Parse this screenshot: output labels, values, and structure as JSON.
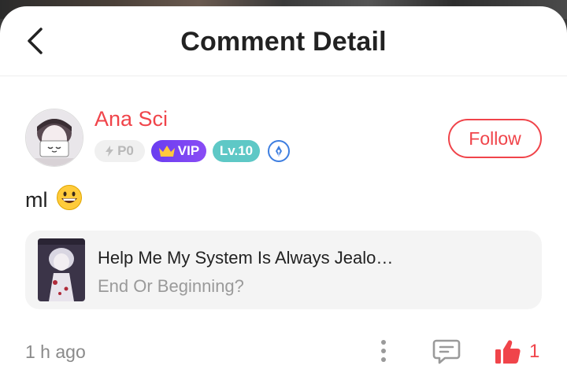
{
  "header": {
    "title": "Comment Detail"
  },
  "comment": {
    "username": "Ana Sci",
    "badges": {
      "power": "P0",
      "vip": "VIP",
      "level": "Lv.10"
    },
    "follow_label": "Follow",
    "text": "ml",
    "emoji": "😀",
    "time": "1 h ago",
    "like_count": "1"
  },
  "book": {
    "title": "Help Me My System Is Always Jealo…",
    "chapter": "End Or Beginning?"
  },
  "colors": {
    "accent": "#f0444a",
    "vip": "#7a45f2",
    "level": "#5ec8c6",
    "badge_icon": "#3d7ee0"
  },
  "icons": {
    "back": "chevron-left-icon",
    "bolt": "lightning-icon",
    "crown": "crown-icon",
    "pen": "pen-nib-icon",
    "more": "more-vertical-icon",
    "reply": "comment-bubble-icon",
    "like": "thumbs-up-icon"
  }
}
